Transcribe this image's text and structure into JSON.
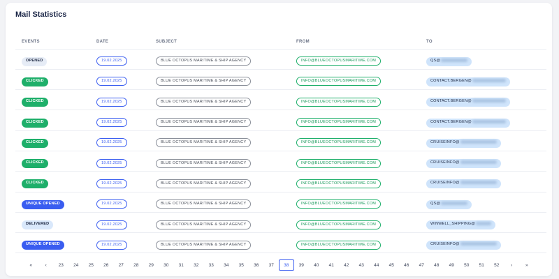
{
  "title": "Mail Statistics",
  "columns": [
    "EVENTS",
    "DATE",
    "SUBJECT",
    "FROM",
    "TO"
  ],
  "rows": [
    {
      "event": "OPENED",
      "date": "19.02.2025",
      "subject": "BLUE OCTOPUS MARITIME & SHIP AGENCY",
      "from": "INFO@BLUEOCTOPUSMARITIME.COM",
      "to": "QS@"
    },
    {
      "event": "CLICKED",
      "date": "19.02.2025",
      "subject": "BLUE OCTOPUS MARITIME & SHIP AGENCY",
      "from": "INFO@BLUEOCTOPUSMARITIME.COM",
      "to": "CONTACT.BERGEN@"
    },
    {
      "event": "CLICKED",
      "date": "19.02.2025",
      "subject": "BLUE OCTOPUS MARITIME & SHIP AGENCY",
      "from": "INFO@BLUEOCTOPUSMARITIME.COM",
      "to": "CONTACT.BERGEN@"
    },
    {
      "event": "CLICKED",
      "date": "19.02.2025",
      "subject": "BLUE OCTOPUS MARITIME & SHIP AGENCY",
      "from": "INFO@BLUEOCTOPUSMARITIME.COM",
      "to": "CONTACT.BERGEN@"
    },
    {
      "event": "CLICKED",
      "date": "19.02.2025",
      "subject": "BLUE OCTOPUS MARITIME & SHIP AGENCY",
      "from": "INFO@BLUEOCTOPUSMARITIME.COM",
      "to": "CRUISEINFO@"
    },
    {
      "event": "CLICKED",
      "date": "19.02.2025",
      "subject": "BLUE OCTOPUS MARITIME & SHIP AGENCY",
      "from": "INFO@BLUEOCTOPUSMARITIME.COM",
      "to": "CRUISEINFO@"
    },
    {
      "event": "CLICKED",
      "date": "19.02.2025",
      "subject": "BLUE OCTOPUS MARITIME & SHIP AGENCY",
      "from": "INFO@BLUEOCTOPUSMARITIME.COM",
      "to": "CRUISEINFO@"
    },
    {
      "event": "UNIQUE OPENED",
      "date": "19.02.2025",
      "subject": "BLUE OCTOPUS MARITIME & SHIP AGENCY",
      "from": "INFO@BLUEOCTOPUSMARITIME.COM",
      "to": "QS@"
    },
    {
      "event": "DELIVERED",
      "date": "19.02.2025",
      "subject": "BLUE OCTOPUS MARITIME & SHIP AGENCY",
      "from": "INFO@BLUEOCTOPUSMARITIME.COM",
      "to": "WINWELL_SHIPPING@"
    },
    {
      "event": "UNIQUE OPENED",
      "date": "19.02.2025",
      "subject": "BLUE OCTOPUS MARITIME & SHIP AGENCY",
      "from": "INFO@BLUEOCTOPUSMARITIME.COM",
      "to": "CRUISEINFO@"
    }
  ],
  "pagination": {
    "first": "«",
    "prev": "‹",
    "pages": [
      "23",
      "24",
      "25",
      "26",
      "27",
      "28",
      "29",
      "30",
      "31",
      "32",
      "33",
      "34",
      "35",
      "36",
      "37",
      "38",
      "39",
      "40",
      "41",
      "42",
      "43",
      "44",
      "45",
      "46",
      "47",
      "48",
      "49",
      "50",
      "51",
      "52"
    ],
    "current": "38",
    "next": "›",
    "last": "»"
  },
  "colors": {
    "opened": "#e6ecf6",
    "clicked": "#1eaf6a",
    "unique_opened": "#3a5df0",
    "delivered": "#d9e8fb",
    "accent": "#3a5df0"
  }
}
